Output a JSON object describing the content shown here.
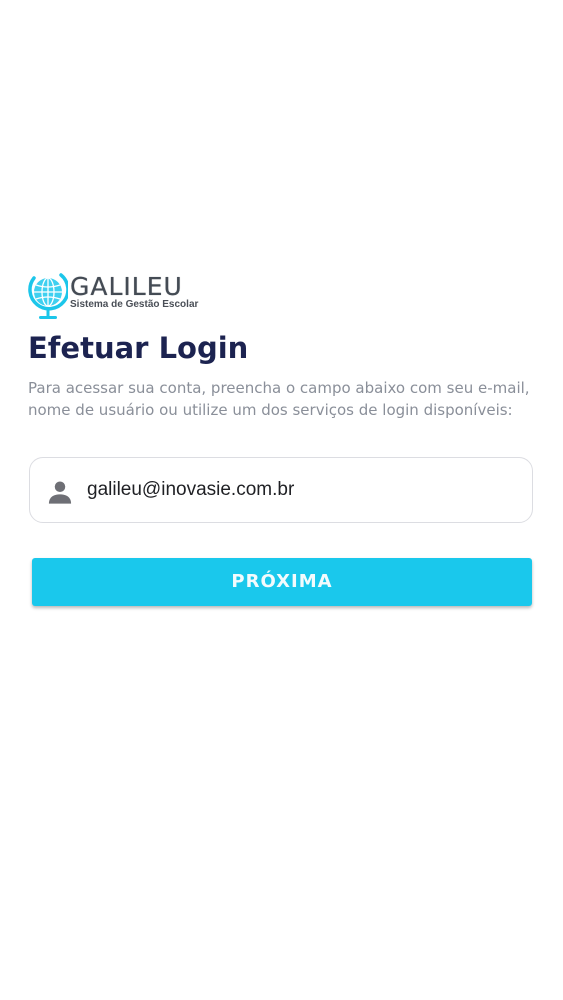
{
  "brand": {
    "name": "GALILEU",
    "tagline": "Sistema de Gestão Escolar",
    "accent_color": "#1ac8ec",
    "icon": "globe-icon"
  },
  "login": {
    "title": "Efetuar Login",
    "subtitle": "Para acessar sua conta, preencha o campo abaixo com seu e-mail, nome de usuário ou utilize um dos serviços de login disponíveis:",
    "field": {
      "icon": "user-icon",
      "value": "galileu@inovasie.com.br"
    },
    "next_label": "PRÓXIMA"
  },
  "colors": {
    "title": "#1c2350",
    "button": "#1ac8ec",
    "button_text": "#f3fbfd"
  }
}
